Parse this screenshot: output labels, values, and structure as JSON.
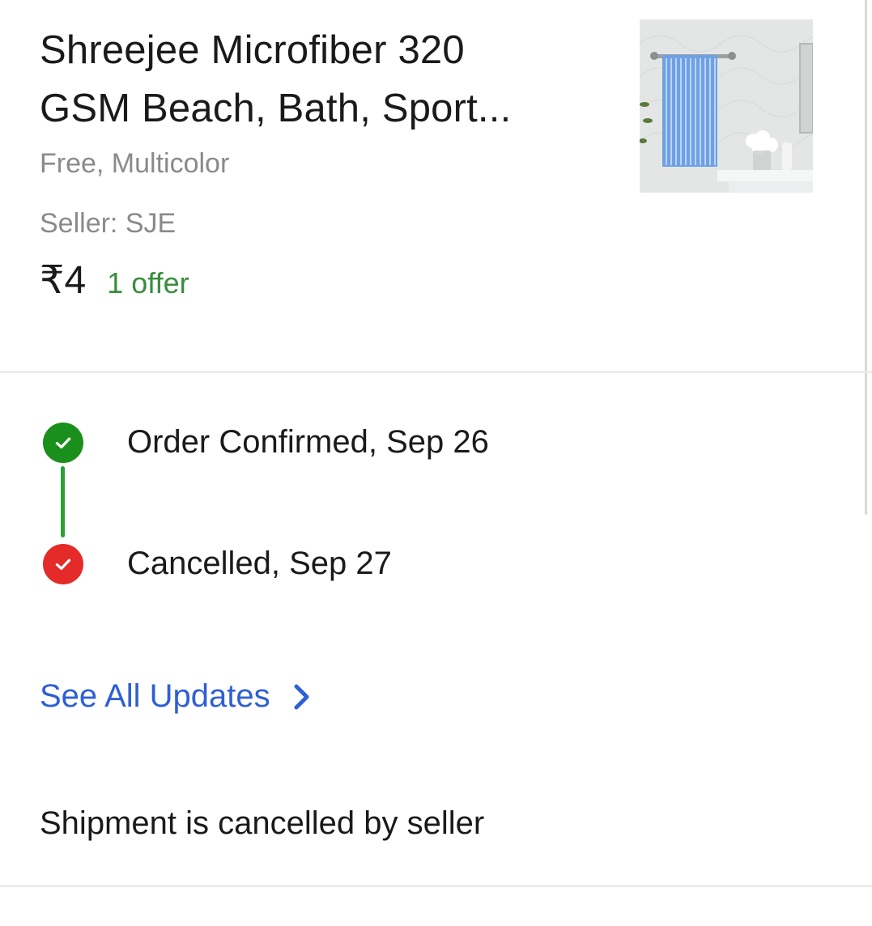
{
  "product": {
    "title_line1": "Shreejee Microfiber 320",
    "title_line2": "GSM Beach, Bath, Sport...",
    "variant": "Free, Multicolor",
    "seller": "Seller: SJE",
    "price": "₹4",
    "offer": "1 offer",
    "image_alt": "Blue striped towel hanging on bathroom rail"
  },
  "timeline": [
    {
      "label": "Order Confirmed, Sep 26",
      "status": "confirmed",
      "color": "#1b8f1b"
    },
    {
      "label": "Cancelled, Sep 27",
      "status": "cancelled",
      "color": "#e52a2a"
    }
  ],
  "see_all": {
    "label": "See All Updates"
  },
  "shipment_message": "Shipment is cancelled by seller",
  "colors": {
    "link": "#2f5fd6",
    "offer": "#388e3c",
    "muted": "#8a8a8a"
  },
  "icons": {
    "confirmed": "check-circle-icon",
    "cancelled": "check-circle-icon",
    "see_all": "chevron-right-icon"
  }
}
